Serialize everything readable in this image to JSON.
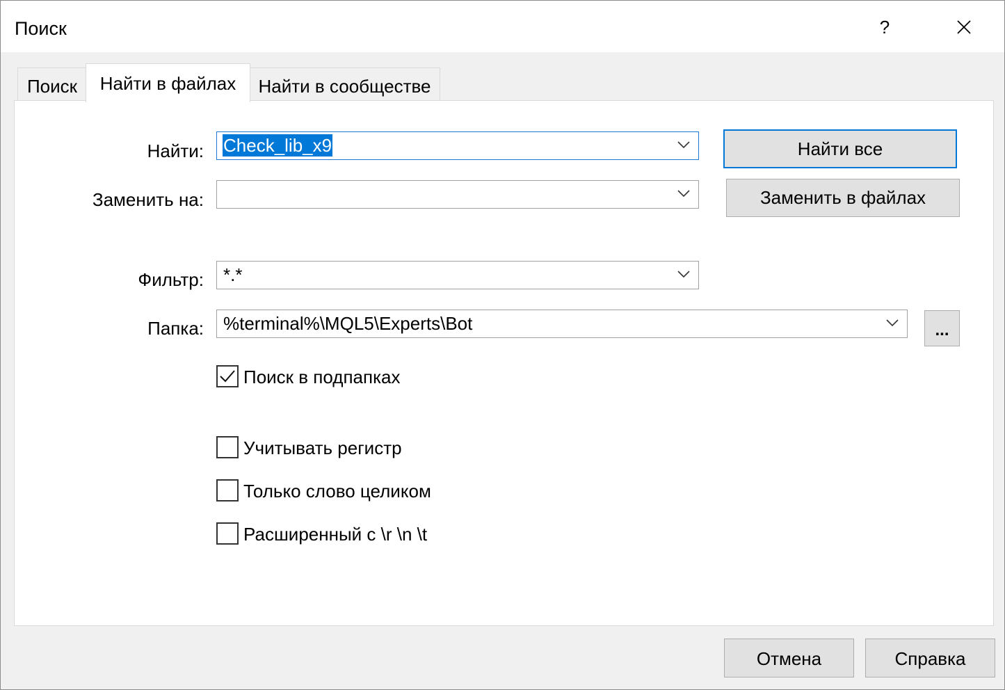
{
  "window": {
    "title": "Поиск",
    "help_label": "?"
  },
  "tabs": [
    {
      "label": "Поиск",
      "active": false
    },
    {
      "label": "Найти в файлах",
      "active": true
    },
    {
      "label": "Найти в сообществе",
      "active": false
    }
  ],
  "form": {
    "find": {
      "label": "Найти:",
      "value": "Check_lib_x9"
    },
    "replace": {
      "label": "Заменить на:",
      "value": ""
    },
    "filter": {
      "label": "Фильтр:",
      "value": "*.*"
    },
    "folder": {
      "label": "Папка:",
      "value": "%terminal%\\MQL5\\Experts\\Bot",
      "browse_label": "..."
    }
  },
  "buttons": {
    "find_all": "Найти все",
    "replace_in_files": "Заменить в файлах",
    "cancel": "Отмена",
    "help": "Справка"
  },
  "options": [
    {
      "label": "Поиск в подпапках",
      "checked": true
    },
    {
      "label": "Учитывать регистр",
      "checked": false
    },
    {
      "label": "Только слово целиком",
      "checked": false
    },
    {
      "label": "Расширенный с \\r \\n \\t",
      "checked": false
    }
  ],
  "colors": {
    "accent": "#0078d7",
    "dialog_bg": "#f0f0f0",
    "panel_bg": "#ffffff",
    "button_bg": "#e1e1e1"
  }
}
